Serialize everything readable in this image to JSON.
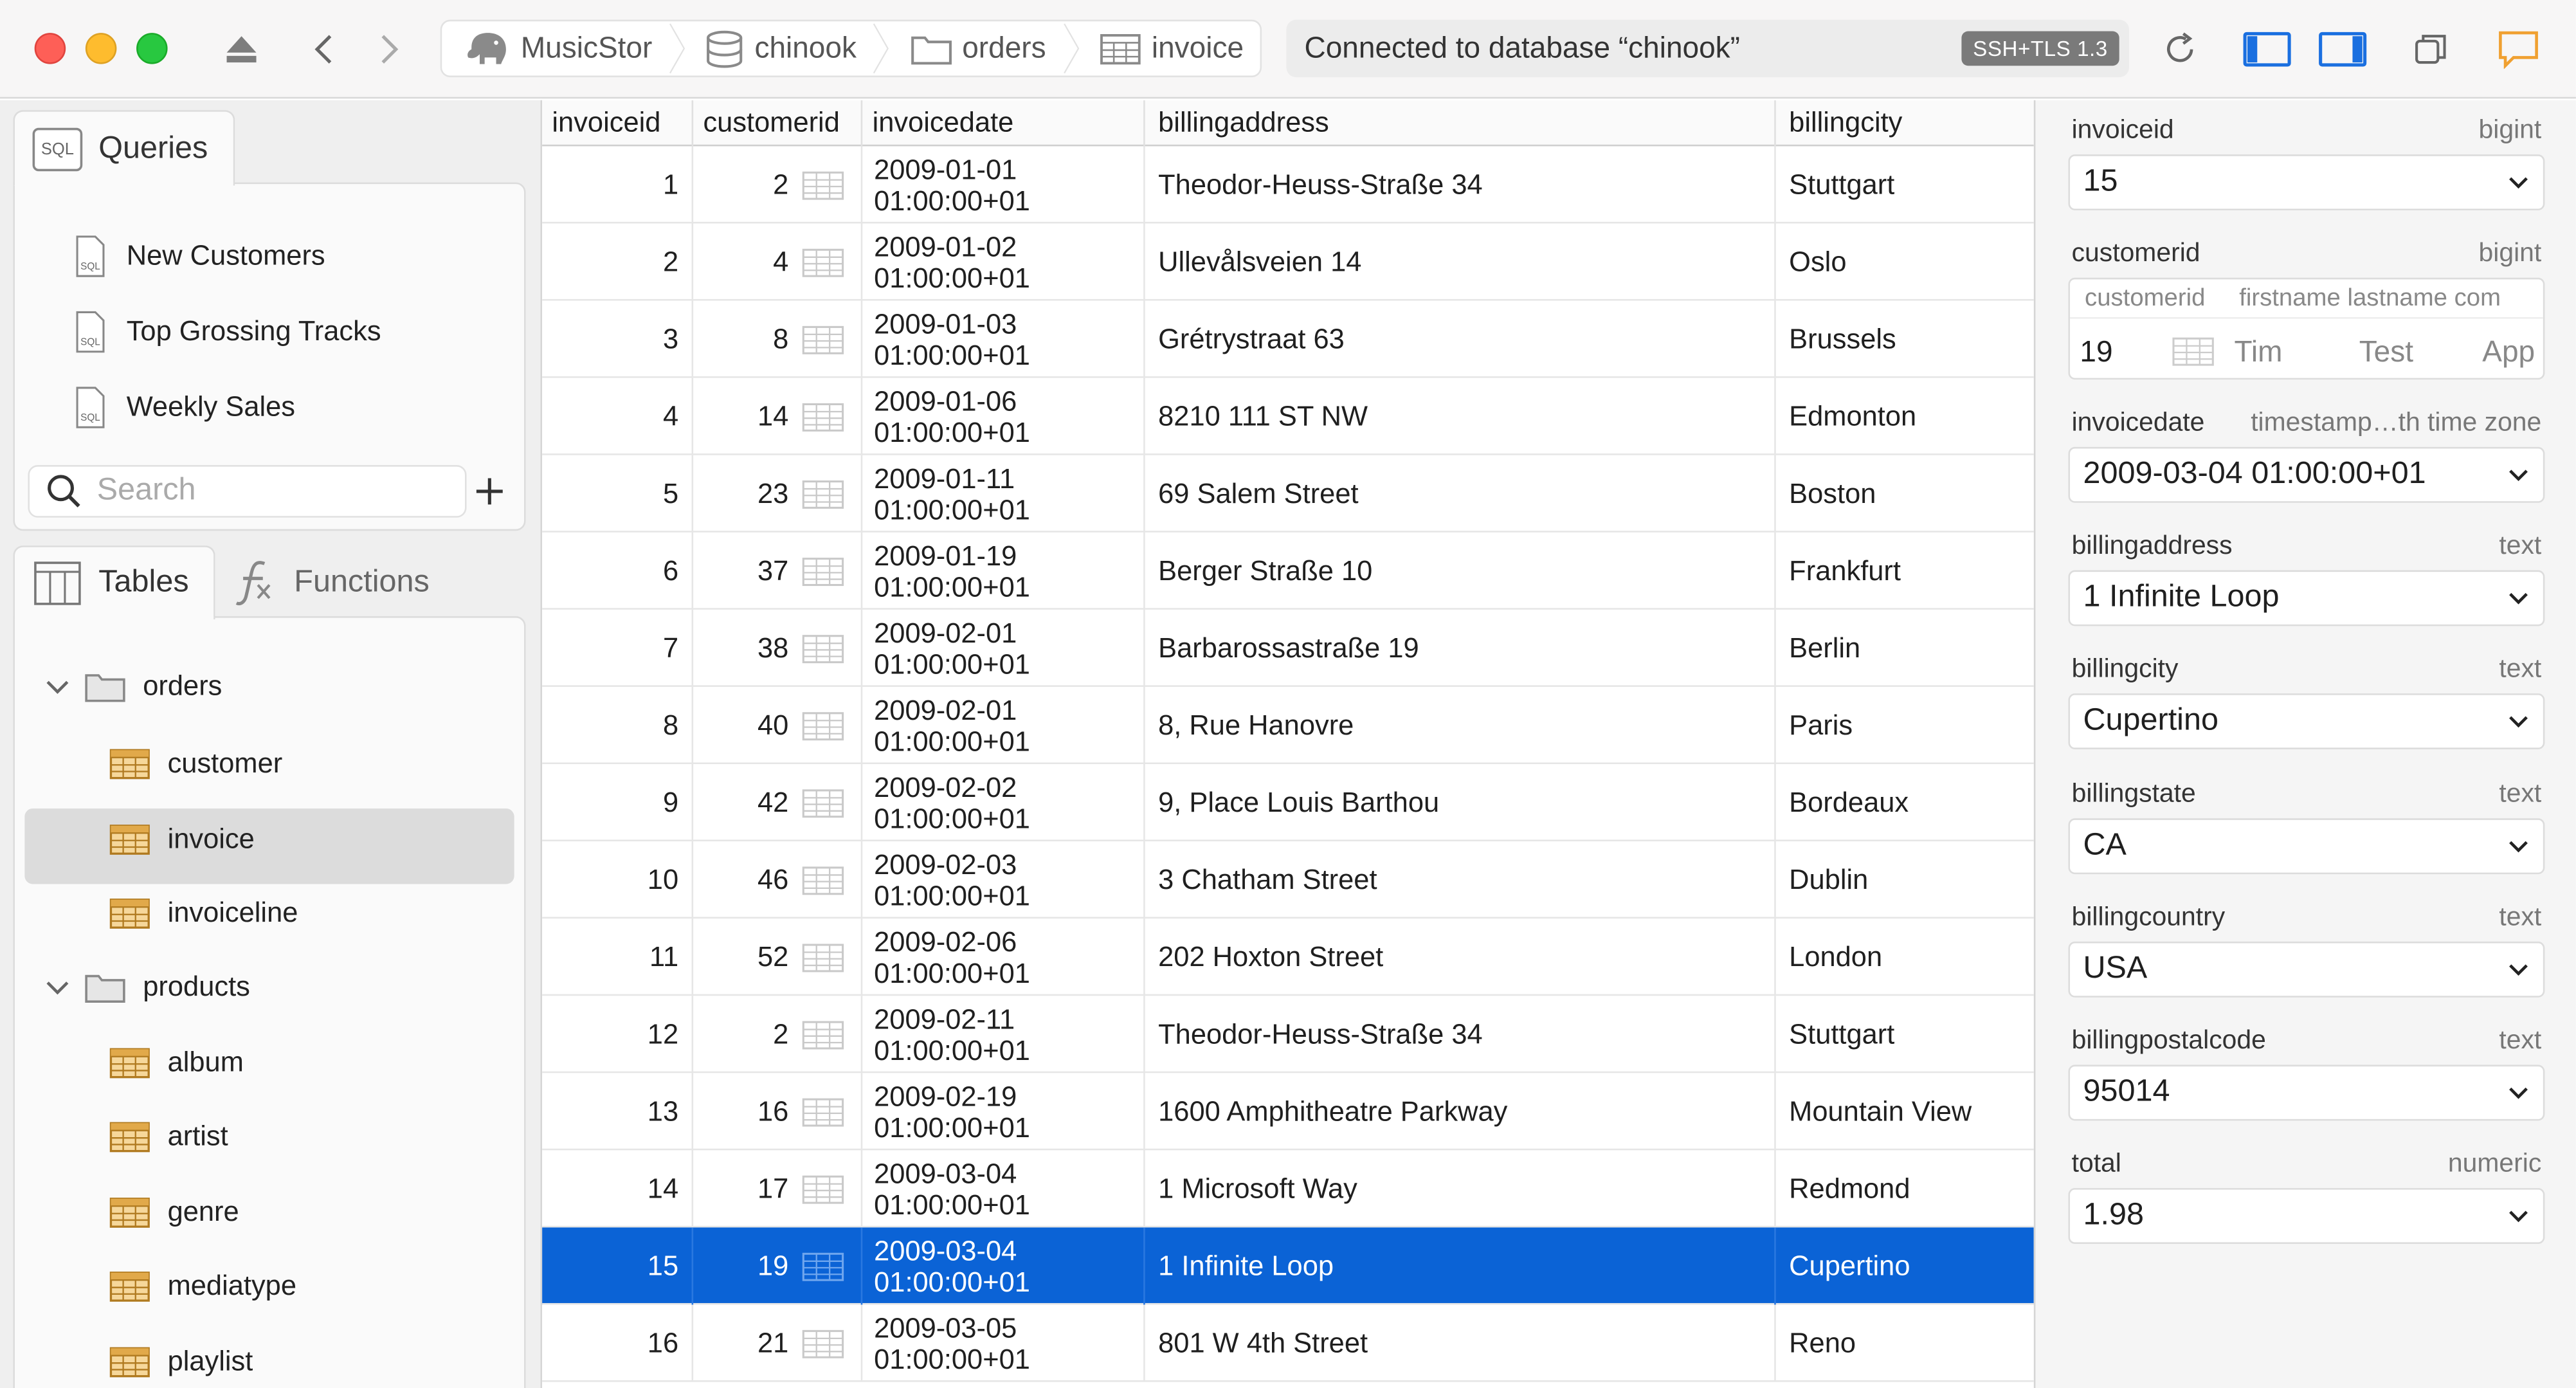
{
  "toolbar": {
    "breadcrumbs": [
      {
        "label": "MusicStor",
        "icon": "elephant-icon"
      },
      {
        "label": "chinook",
        "icon": "database-icon"
      },
      {
        "label": "orders",
        "icon": "folder-icon"
      },
      {
        "label": "invoice",
        "icon": "table-icon"
      }
    ],
    "status": "Connected to database “chinook”",
    "badge": "SSH+TLS 1.3"
  },
  "sidebar": {
    "queries_tab": "Queries",
    "queries": [
      "New Customers",
      "Top Grossing Tracks",
      "Weekly Sales"
    ],
    "search_placeholder": "Search",
    "tables_tab": "Tables",
    "functions_tab": "Functions",
    "tree": {
      "orders": {
        "label": "orders",
        "items": [
          "customer",
          "invoice",
          "invoiceline"
        ]
      },
      "products": {
        "label": "products",
        "items": [
          "album",
          "artist",
          "genre",
          "mediatype",
          "playlist"
        ]
      }
    },
    "selected": "invoice"
  },
  "grid": {
    "columns": [
      "invoiceid",
      "customerid",
      "invoicedate",
      "billingaddress",
      "billingcity"
    ],
    "selected_index": 14,
    "rows": [
      {
        "invoiceid": "1",
        "customerid": "2",
        "date": "2009-01-01",
        "time": "01:00:00+01",
        "address": "Theodor-Heuss-Straße 34",
        "city": "Stuttgart"
      },
      {
        "invoiceid": "2",
        "customerid": "4",
        "date": "2009-01-02",
        "time": "01:00:00+01",
        "address": "Ullevålsveien 14",
        "city": "Oslo"
      },
      {
        "invoiceid": "3",
        "customerid": "8",
        "date": "2009-01-03",
        "time": "01:00:00+01",
        "address": "Grétrystraat 63",
        "city": "Brussels"
      },
      {
        "invoiceid": "4",
        "customerid": "14",
        "date": "2009-01-06",
        "time": "01:00:00+01",
        "address": "8210 111 ST NW",
        "city": "Edmonton"
      },
      {
        "invoiceid": "5",
        "customerid": "23",
        "date": "2009-01-11",
        "time": "01:00:00+01",
        "address": "69 Salem Street",
        "city": "Boston"
      },
      {
        "invoiceid": "6",
        "customerid": "37",
        "date": "2009-01-19",
        "time": "01:00:00+01",
        "address": "Berger Straße 10",
        "city": "Frankfurt"
      },
      {
        "invoiceid": "7",
        "customerid": "38",
        "date": "2009-02-01",
        "time": "01:00:00+01",
        "address": "Barbarossastraße 19",
        "city": "Berlin"
      },
      {
        "invoiceid": "8",
        "customerid": "40",
        "date": "2009-02-01",
        "time": "01:00:00+01",
        "address": "8, Rue Hanovre",
        "city": "Paris"
      },
      {
        "invoiceid": "9",
        "customerid": "42",
        "date": "2009-02-02",
        "time": "01:00:00+01",
        "address": "9, Place Louis Barthou",
        "city": "Bordeaux"
      },
      {
        "invoiceid": "10",
        "customerid": "46",
        "date": "2009-02-03",
        "time": "01:00:00+01",
        "address": "3 Chatham Street",
        "city": "Dublin"
      },
      {
        "invoiceid": "11",
        "customerid": "52",
        "date": "2009-02-06",
        "time": "01:00:00+01",
        "address": "202 Hoxton Street",
        "city": "London"
      },
      {
        "invoiceid": "12",
        "customerid": "2",
        "date": "2009-02-11",
        "time": "01:00:00+01",
        "address": "Theodor-Heuss-Straße 34",
        "city": "Stuttgart"
      },
      {
        "invoiceid": "13",
        "customerid": "16",
        "date": "2009-02-19",
        "time": "01:00:00+01",
        "address": "1600 Amphitheatre Parkway",
        "city": "Mountain View"
      },
      {
        "invoiceid": "14",
        "customerid": "17",
        "date": "2009-03-04",
        "time": "01:00:00+01",
        "address": "1 Microsoft Way",
        "city": "Redmond"
      },
      {
        "invoiceid": "15",
        "customerid": "19",
        "date": "2009-03-04",
        "time": "01:00:00+01",
        "address": "1 Infinite Loop",
        "city": "Cupertino"
      },
      {
        "invoiceid": "16",
        "customerid": "21",
        "date": "2009-03-05",
        "time": "01:00:00+01",
        "address": "801 W 4th Street",
        "city": "Reno"
      }
    ]
  },
  "detail": {
    "invoiceid": {
      "label": "invoiceid",
      "type": "bigint",
      "value": "15"
    },
    "customerid": {
      "label": "customerid",
      "type": "bigint",
      "columns": [
        "customerid",
        "firstname",
        "lastname",
        "com"
      ],
      "values": [
        "19",
        "Tim",
        "Test",
        "App"
      ]
    },
    "fields": [
      {
        "label": "invoicedate",
        "type": "timestamp…th time zone",
        "value": "2009-03-04 01:00:00+01"
      },
      {
        "label": "billingaddress",
        "type": "text",
        "value": "1 Infinite Loop"
      },
      {
        "label": "billingcity",
        "type": "text",
        "value": "Cupertino"
      },
      {
        "label": "billingstate",
        "type": "text",
        "value": "CA"
      },
      {
        "label": "billingcountry",
        "type": "text",
        "value": "USA"
      },
      {
        "label": "billingpostalcode",
        "type": "text",
        "value": "95014"
      },
      {
        "label": "total",
        "type": "numeric",
        "value": "1.98"
      }
    ]
  },
  "colors": {
    "selection": "#0b63d6",
    "accent": "#1a6fe0",
    "comment": "#f0a030"
  }
}
